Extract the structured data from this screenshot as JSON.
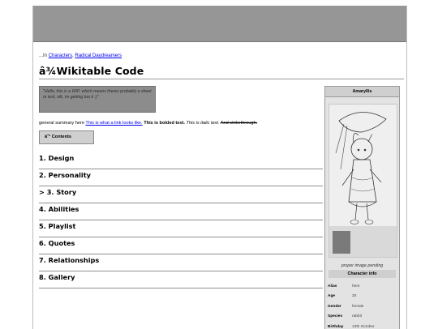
{
  "breadcrumb": {
    "prefix": "...In",
    "links": [
      "Characters",
      "Radical Daydreamers"
    ],
    "separator": ","
  },
  "page": {
    "title": "â¾Wikitable Code"
  },
  "quote": {
    "text": "\"Hello, this is a WIP, which means theres probably a sheet or text, idk, im getting too it :)\""
  },
  "summary": {
    "lead": "general summary here",
    "link_text": "This is what a link looks like.",
    "bold_text": "This is bolded text.",
    "italic_text": "This is italic text.",
    "strike_text": "And strikethrough."
  },
  "toc": {
    "label": "â˜° Contents"
  },
  "sections": [
    "1. Design",
    "2. Personality",
    "> 3. Story",
    "4. Abilities",
    "5. Playlist",
    "6. Quotes",
    "7. Relationships",
    "8. Gallery"
  ],
  "infobox": {
    "name": "Amaryllis",
    "image_caption": "proper image pending",
    "section_title": "Character info",
    "rows": [
      {
        "key": "Alias",
        "value": "here"
      },
      {
        "key": "Age",
        "value": "20"
      },
      {
        "key": "Gender",
        "value": "female"
      },
      {
        "key": "Species",
        "value": "rabbit"
      },
      {
        "key": "Birthday",
        "value": "13th October"
      }
    ]
  },
  "colors": {
    "banner": "#969696",
    "quote_bg": "#8c8c8c",
    "infobox_bg": "#e3e3e3",
    "link": "#0000ee"
  }
}
